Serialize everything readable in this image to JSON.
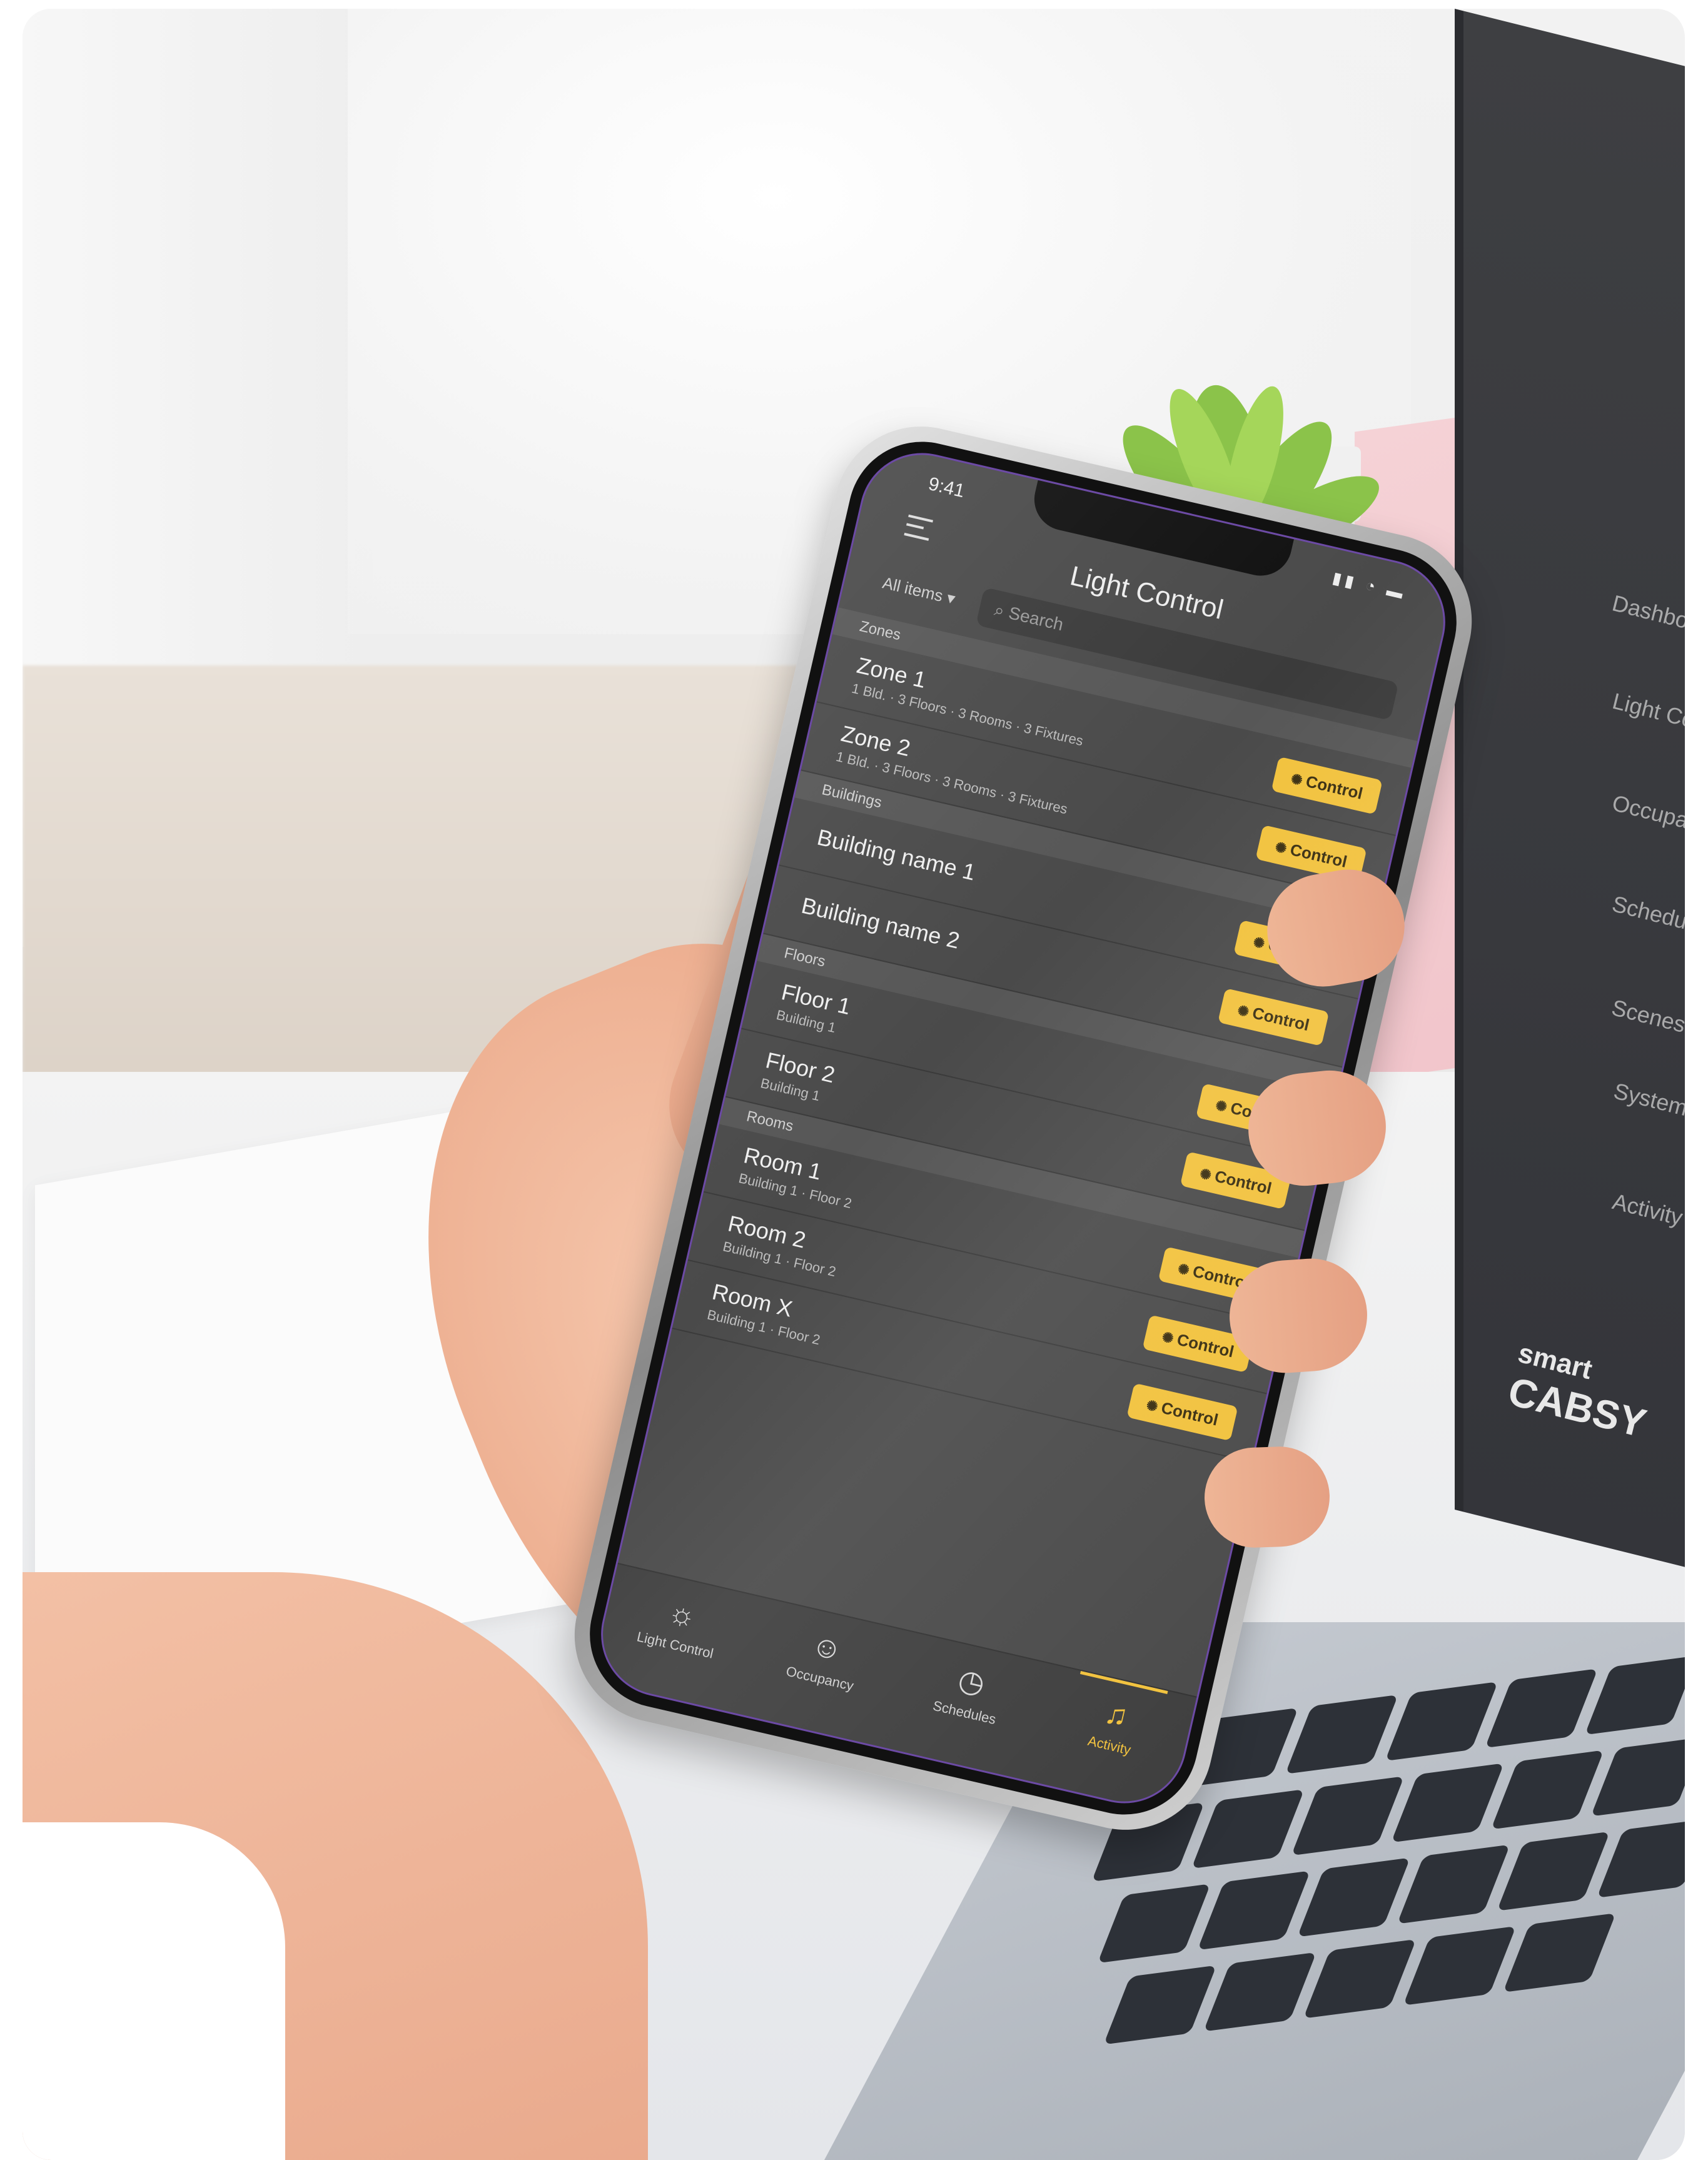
{
  "phone": {
    "status_time": "9:41",
    "app_title": "Light Control",
    "filter_label": "All items ▾",
    "search_placeholder": "Search",
    "sections": [
      {
        "label": "Zones",
        "rows": [
          {
            "title": "Zone 1",
            "subtitle": "1 Bld. · 3 Floors · 3 Rooms · 3 Fixtures",
            "button": "Control"
          },
          {
            "title": "Zone 2",
            "subtitle": "1 Bld. · 3 Floors · 3 Rooms · 3 Fixtures",
            "button": "Control"
          }
        ]
      },
      {
        "label": "Buildings",
        "rows": [
          {
            "title": "Building name 1",
            "subtitle": "",
            "button": "Control"
          },
          {
            "title": "Building name 2",
            "subtitle": "",
            "button": "Control"
          }
        ]
      },
      {
        "label": "Floors",
        "rows": [
          {
            "title": "Floor 1",
            "subtitle": "Building 1",
            "button": "Control"
          },
          {
            "title": "Floor 2",
            "subtitle": "Building 1",
            "button": "Control"
          }
        ]
      },
      {
        "label": "Rooms",
        "rows": [
          {
            "title": "Room 1",
            "subtitle": "Building 1 · Floor 2",
            "button": "Control"
          },
          {
            "title": "Room 2",
            "subtitle": "Building 1 · Floor 2",
            "button": "Control"
          },
          {
            "title": "Room X",
            "subtitle": "Building 1 · Floor 2",
            "button": "Control"
          }
        ]
      }
    ],
    "tabs": [
      {
        "label": "Light Control",
        "icon": "sun-icon"
      },
      {
        "label": "Occupancy",
        "icon": "person-icon"
      },
      {
        "label": "Schedules",
        "icon": "clock-icon"
      },
      {
        "label": "Activity",
        "icon": "bell-icon"
      }
    ],
    "active_tab": "Activity",
    "accent": "#f2c23d"
  },
  "laptop": {
    "menu": [
      "Dashboard",
      "Light Control",
      "Occupancy",
      "Schedules",
      "Scenes",
      "System Management",
      "Activity Logs"
    ],
    "brand": "CABSY",
    "tagline": "smart"
  }
}
